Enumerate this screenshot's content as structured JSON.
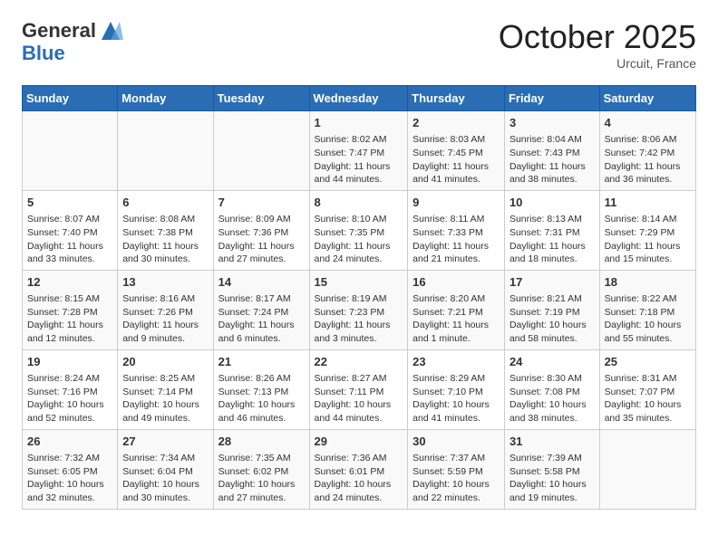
{
  "header": {
    "logo_general": "General",
    "logo_blue": "Blue",
    "month": "October 2025",
    "location": "Urcuit, France"
  },
  "days_of_week": [
    "Sunday",
    "Monday",
    "Tuesday",
    "Wednesday",
    "Thursday",
    "Friday",
    "Saturday"
  ],
  "weeks": [
    [
      {
        "day": "",
        "info": ""
      },
      {
        "day": "",
        "info": ""
      },
      {
        "day": "",
        "info": ""
      },
      {
        "day": "1",
        "info": "Sunrise: 8:02 AM\nSunset: 7:47 PM\nDaylight: 11 hours and 44 minutes."
      },
      {
        "day": "2",
        "info": "Sunrise: 8:03 AM\nSunset: 7:45 PM\nDaylight: 11 hours and 41 minutes."
      },
      {
        "day": "3",
        "info": "Sunrise: 8:04 AM\nSunset: 7:43 PM\nDaylight: 11 hours and 38 minutes."
      },
      {
        "day": "4",
        "info": "Sunrise: 8:06 AM\nSunset: 7:42 PM\nDaylight: 11 hours and 36 minutes."
      }
    ],
    [
      {
        "day": "5",
        "info": "Sunrise: 8:07 AM\nSunset: 7:40 PM\nDaylight: 11 hours and 33 minutes."
      },
      {
        "day": "6",
        "info": "Sunrise: 8:08 AM\nSunset: 7:38 PM\nDaylight: 11 hours and 30 minutes."
      },
      {
        "day": "7",
        "info": "Sunrise: 8:09 AM\nSunset: 7:36 PM\nDaylight: 11 hours and 27 minutes."
      },
      {
        "day": "8",
        "info": "Sunrise: 8:10 AM\nSunset: 7:35 PM\nDaylight: 11 hours and 24 minutes."
      },
      {
        "day": "9",
        "info": "Sunrise: 8:11 AM\nSunset: 7:33 PM\nDaylight: 11 hours and 21 minutes."
      },
      {
        "day": "10",
        "info": "Sunrise: 8:13 AM\nSunset: 7:31 PM\nDaylight: 11 hours and 18 minutes."
      },
      {
        "day": "11",
        "info": "Sunrise: 8:14 AM\nSunset: 7:29 PM\nDaylight: 11 hours and 15 minutes."
      }
    ],
    [
      {
        "day": "12",
        "info": "Sunrise: 8:15 AM\nSunset: 7:28 PM\nDaylight: 11 hours and 12 minutes."
      },
      {
        "day": "13",
        "info": "Sunrise: 8:16 AM\nSunset: 7:26 PM\nDaylight: 11 hours and 9 minutes."
      },
      {
        "day": "14",
        "info": "Sunrise: 8:17 AM\nSunset: 7:24 PM\nDaylight: 11 hours and 6 minutes."
      },
      {
        "day": "15",
        "info": "Sunrise: 8:19 AM\nSunset: 7:23 PM\nDaylight: 11 hours and 3 minutes."
      },
      {
        "day": "16",
        "info": "Sunrise: 8:20 AM\nSunset: 7:21 PM\nDaylight: 11 hours and 1 minute."
      },
      {
        "day": "17",
        "info": "Sunrise: 8:21 AM\nSunset: 7:19 PM\nDaylight: 10 hours and 58 minutes."
      },
      {
        "day": "18",
        "info": "Sunrise: 8:22 AM\nSunset: 7:18 PM\nDaylight: 10 hours and 55 minutes."
      }
    ],
    [
      {
        "day": "19",
        "info": "Sunrise: 8:24 AM\nSunset: 7:16 PM\nDaylight: 10 hours and 52 minutes."
      },
      {
        "day": "20",
        "info": "Sunrise: 8:25 AM\nSunset: 7:14 PM\nDaylight: 10 hours and 49 minutes."
      },
      {
        "day": "21",
        "info": "Sunrise: 8:26 AM\nSunset: 7:13 PM\nDaylight: 10 hours and 46 minutes."
      },
      {
        "day": "22",
        "info": "Sunrise: 8:27 AM\nSunset: 7:11 PM\nDaylight: 10 hours and 44 minutes."
      },
      {
        "day": "23",
        "info": "Sunrise: 8:29 AM\nSunset: 7:10 PM\nDaylight: 10 hours and 41 minutes."
      },
      {
        "day": "24",
        "info": "Sunrise: 8:30 AM\nSunset: 7:08 PM\nDaylight: 10 hours and 38 minutes."
      },
      {
        "day": "25",
        "info": "Sunrise: 8:31 AM\nSunset: 7:07 PM\nDaylight: 10 hours and 35 minutes."
      }
    ],
    [
      {
        "day": "26",
        "info": "Sunrise: 7:32 AM\nSunset: 6:05 PM\nDaylight: 10 hours and 32 minutes."
      },
      {
        "day": "27",
        "info": "Sunrise: 7:34 AM\nSunset: 6:04 PM\nDaylight: 10 hours and 30 minutes."
      },
      {
        "day": "28",
        "info": "Sunrise: 7:35 AM\nSunset: 6:02 PM\nDaylight: 10 hours and 27 minutes."
      },
      {
        "day": "29",
        "info": "Sunrise: 7:36 AM\nSunset: 6:01 PM\nDaylight: 10 hours and 24 minutes."
      },
      {
        "day": "30",
        "info": "Sunrise: 7:37 AM\nSunset: 5:59 PM\nDaylight: 10 hours and 22 minutes."
      },
      {
        "day": "31",
        "info": "Sunrise: 7:39 AM\nSunset: 5:58 PM\nDaylight: 10 hours and 19 minutes."
      },
      {
        "day": "",
        "info": ""
      }
    ]
  ]
}
